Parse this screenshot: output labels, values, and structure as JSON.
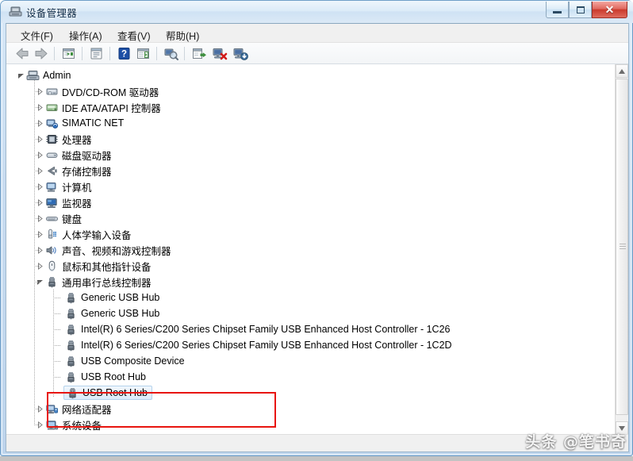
{
  "window": {
    "title": "设备管理器",
    "title_icon": "device-manager-icon",
    "buttons": {
      "minimize": "—",
      "maximize": "❐",
      "close": "✕"
    }
  },
  "menu": {
    "items": [
      {
        "label": "文件(F)",
        "name": "menu-file"
      },
      {
        "label": "操作(A)",
        "name": "menu-action"
      },
      {
        "label": "查看(V)",
        "name": "menu-view"
      },
      {
        "label": "帮助(H)",
        "name": "menu-help"
      }
    ]
  },
  "toolbar": {
    "items": [
      {
        "name": "back-icon",
        "tooltip": "后退"
      },
      {
        "name": "forward-icon",
        "tooltip": "前进"
      },
      {
        "name": "up-one-level-icon",
        "tooltip": "上移一级"
      },
      {
        "name": "properties-icon",
        "tooltip": "属性"
      },
      {
        "name": "help-icon",
        "tooltip": "帮助"
      },
      {
        "name": "show-hidden-devices-icon",
        "tooltip": "显示隐藏的设备"
      },
      {
        "name": "scan-hardware-changes-icon",
        "tooltip": "扫描检测硬件改动"
      },
      {
        "name": "update-driver-icon",
        "tooltip": "更新驱动程序软件"
      },
      {
        "name": "disable-device-icon",
        "tooltip": "禁用"
      },
      {
        "name": "uninstall-device-icon",
        "tooltip": "卸载"
      }
    ]
  },
  "tree": {
    "root": {
      "label": "Admin",
      "icon": "computer-icon",
      "expanded": true
    },
    "nodes": [
      {
        "label": "DVD/CD-ROM 驱动器",
        "icon": "dvd-drive-icon",
        "level": 1,
        "expanded": false,
        "selected": false
      },
      {
        "label": "IDE ATA/ATAPI 控制器",
        "icon": "ide-controller-icon",
        "level": 1,
        "expanded": false,
        "selected": false
      },
      {
        "label": "SIMATIC NET",
        "icon": "network-card-icon",
        "level": 1,
        "expanded": false,
        "selected": false
      },
      {
        "label": "处理器",
        "icon": "processor-icon",
        "level": 1,
        "expanded": false,
        "selected": false
      },
      {
        "label": "磁盘驱动器",
        "icon": "disk-drive-icon",
        "level": 1,
        "expanded": false,
        "selected": false
      },
      {
        "label": "存储控制器",
        "icon": "storage-controller-icon",
        "level": 1,
        "expanded": false,
        "selected": false
      },
      {
        "label": "计算机",
        "icon": "computer-node-icon",
        "level": 1,
        "expanded": false,
        "selected": false
      },
      {
        "label": "监视器",
        "icon": "monitor-icon",
        "level": 1,
        "expanded": false,
        "selected": false
      },
      {
        "label": "键盘",
        "icon": "keyboard-icon",
        "level": 1,
        "expanded": false,
        "selected": false
      },
      {
        "label": "人体学输入设备",
        "icon": "hid-icon",
        "level": 1,
        "expanded": false,
        "selected": false
      },
      {
        "label": "声音、视频和游戏控制器",
        "icon": "sound-icon",
        "level": 1,
        "expanded": false,
        "selected": false
      },
      {
        "label": "鼠标和其他指针设备",
        "icon": "mouse-icon",
        "level": 1,
        "expanded": false,
        "selected": false
      },
      {
        "label": "通用串行总线控制器",
        "icon": "usb-icon",
        "level": 1,
        "expanded": true,
        "selected": false
      },
      {
        "label": "Generic USB Hub",
        "icon": "usb-icon",
        "level": 2,
        "expanded": null,
        "selected": false
      },
      {
        "label": "Generic USB Hub",
        "icon": "usb-icon",
        "level": 2,
        "expanded": null,
        "selected": false
      },
      {
        "label": "Intel(R) 6 Series/C200 Series Chipset Family USB Enhanced Host Controller - 1C26",
        "icon": "usb-icon",
        "level": 2,
        "expanded": null,
        "selected": false
      },
      {
        "label": "Intel(R) 6 Series/C200 Series Chipset Family USB Enhanced Host Controller - 1C2D",
        "icon": "usb-icon",
        "level": 2,
        "expanded": null,
        "selected": false
      },
      {
        "label": "USB Composite Device",
        "icon": "usb-icon",
        "level": 2,
        "expanded": null,
        "selected": false
      },
      {
        "label": "USB Root Hub",
        "icon": "usb-icon",
        "level": 2,
        "expanded": null,
        "selected": false
      },
      {
        "label": "USB Root Hub",
        "icon": "usb-icon",
        "level": 2,
        "expanded": null,
        "selected": true
      },
      {
        "label": "网络适配器",
        "icon": "network-adapter-icon",
        "level": 1,
        "expanded": false,
        "selected": false
      },
      {
        "label": "系统设备",
        "icon": "system-device-icon",
        "level": 1,
        "expanded": false,
        "selected": false
      }
    ]
  },
  "annotation": {
    "red_box": {
      "color": "#e8150f",
      "covers": [
        "USB Root Hub",
        "USB Root Hub"
      ]
    }
  },
  "status_bar": {
    "text": ""
  },
  "watermark": {
    "text": "头条 @笔书奇"
  },
  "scrollbar": {
    "up_arrow": "▲",
    "down_arrow": "▼"
  },
  "colors": {
    "accent": "#e8150f",
    "selection_border": "#b5d2ec",
    "frame": "#6f9fc8"
  }
}
